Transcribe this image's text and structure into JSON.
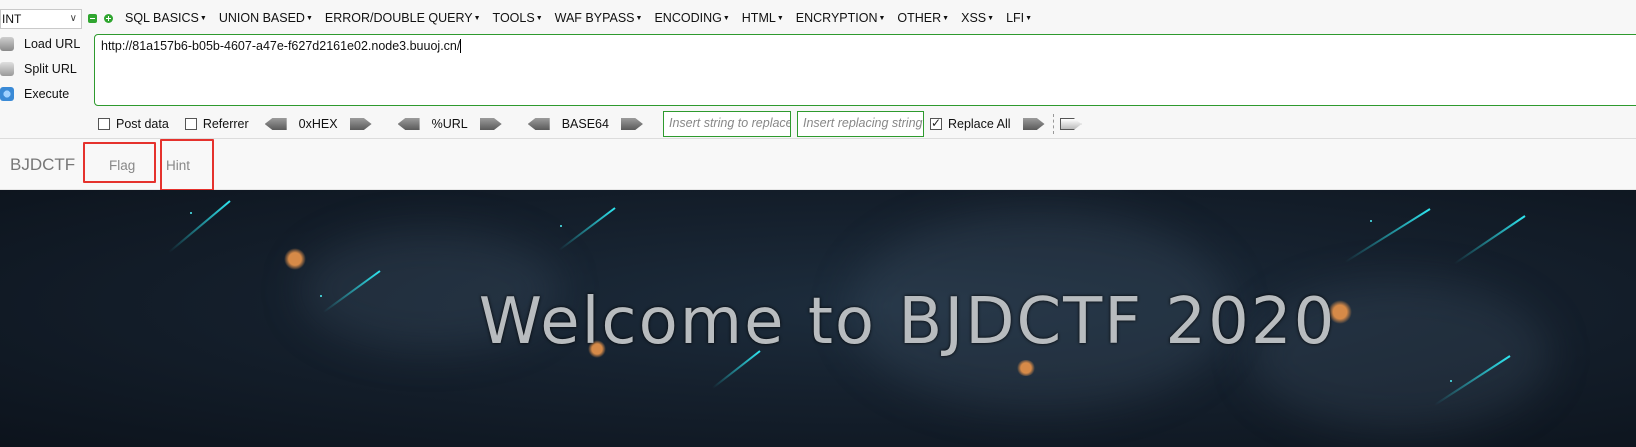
{
  "hackbar": {
    "version_select": "INT",
    "menus": [
      {
        "label": "SQL BASICS"
      },
      {
        "label": "UNION BASED"
      },
      {
        "label": "ERROR/DOUBLE QUERY"
      },
      {
        "label": "TOOLS"
      },
      {
        "label": "WAF BYPASS"
      },
      {
        "label": "ENCODING"
      },
      {
        "label": "HTML"
      },
      {
        "label": "ENCRYPTION"
      },
      {
        "label": "OTHER"
      },
      {
        "label": "XSS"
      },
      {
        "label": "LFI"
      }
    ],
    "actions": {
      "load_url": "Load URL",
      "split_url": "Split URL",
      "execute": "Execute"
    },
    "url_value": "http://81a157b6-b05b-4607-a47e-f627d2161e02.node3.buuoj.cn/",
    "options": {
      "post_data": "Post data",
      "referrer": "Referrer",
      "hex": "0xHEX",
      "url_enc": "%URL",
      "base64": "BASE64",
      "replace_placeholder": "Insert string to replace",
      "replacing_placeholder": "Insert replacing string",
      "replace_all": "Replace All"
    }
  },
  "page": {
    "brand": "BJDCTF",
    "nav": {
      "flag": "Flag",
      "hint": "Hint"
    },
    "welcome": "Welcome to BJDCTF 2020"
  },
  "colors": {
    "highlight": "#e5322d",
    "hackbar_green": "#2e9a2e",
    "meteor": "#2ee6f0"
  }
}
